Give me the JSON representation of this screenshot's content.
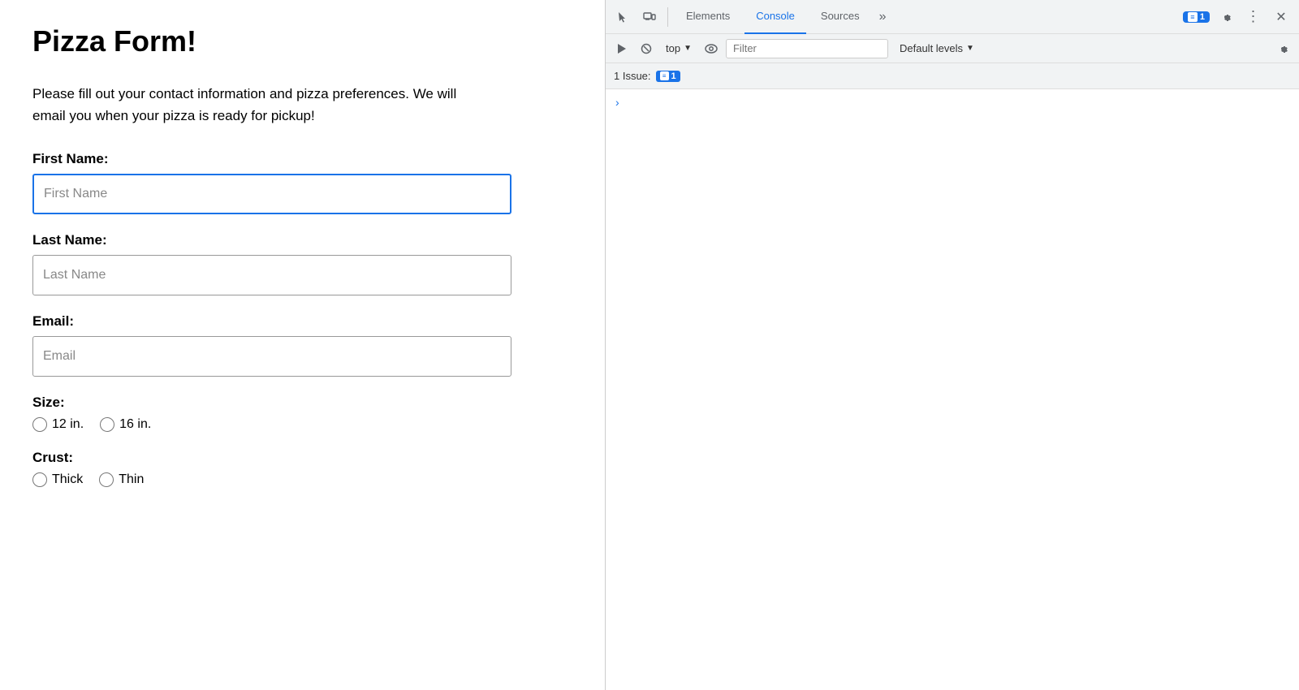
{
  "webpage": {
    "title": "Pizza Form!",
    "description": "Please fill out your contact information and pizza preferences. We will email you when your pizza is ready for pickup!",
    "form": {
      "first_name_label": "First Name:",
      "first_name_placeholder": "First Name",
      "last_name_label": "Last Name:",
      "last_name_placeholder": "Last Name",
      "email_label": "Email:",
      "email_placeholder": "Email",
      "size_label": "Size:",
      "size_options": [
        "12 in.",
        "16 in."
      ],
      "crust_label": "Crust:",
      "crust_options": [
        "Thick",
        "Thin"
      ]
    }
  },
  "devtools": {
    "tabs": [
      "Elements",
      "Console",
      "Sources"
    ],
    "active_tab": "Console",
    "more_label": "»",
    "badge_count": "1",
    "console_bar": {
      "context": "top",
      "filter_placeholder": "Filter",
      "levels_label": "Default levels"
    },
    "issues": {
      "label": "1 Issue:",
      "count": "1"
    }
  }
}
